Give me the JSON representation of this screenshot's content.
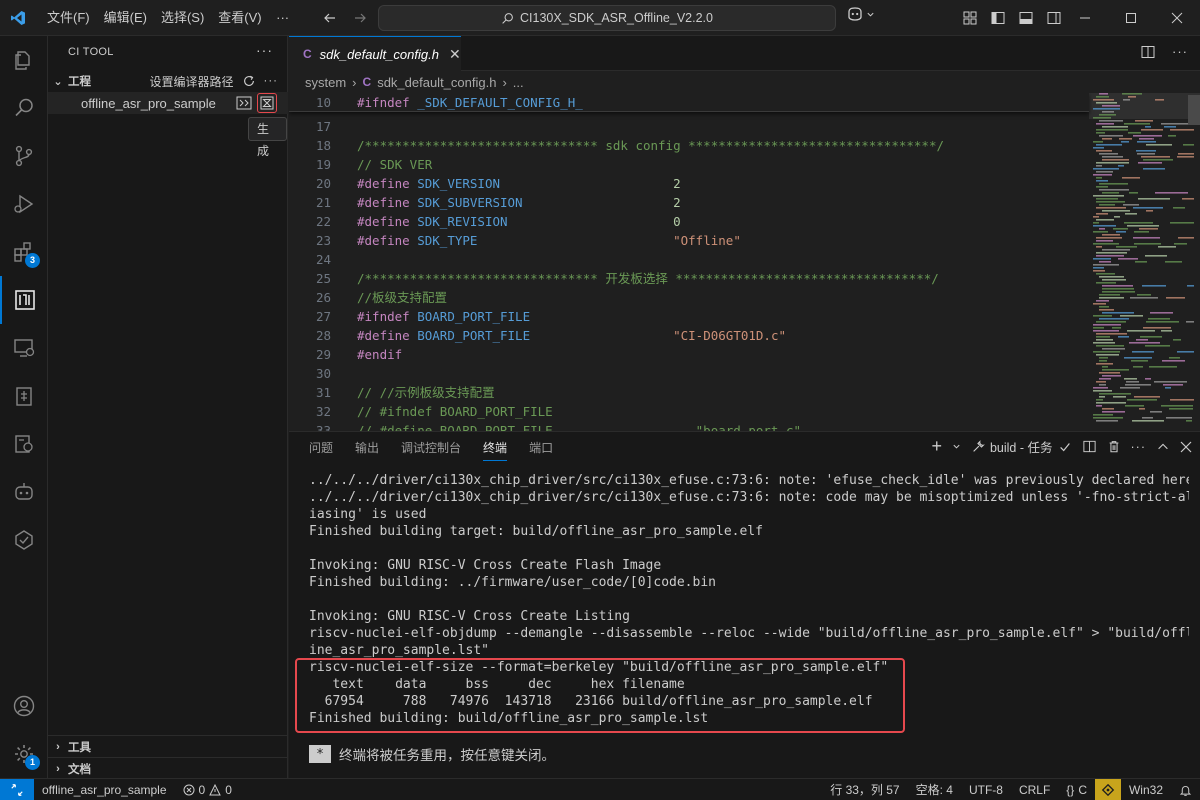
{
  "titlebar": {
    "menus": [
      "文件(F)",
      "编辑(E)",
      "选择(S)",
      "查看(V)",
      "···"
    ],
    "search": "CI130X_SDK_ASR_Offline_V2.2.0"
  },
  "activity_badges": {
    "extensions": "3",
    "manage": "1"
  },
  "sidebar": {
    "title": "CI TOOL",
    "more": "···",
    "project_section": "工程",
    "compiler_path_label": "设置编译器路径",
    "project_item": "offline_asr_pro_sample",
    "tooltip": "生成",
    "tools_section": "工具",
    "docs_section": "文档"
  },
  "editor": {
    "tab_label": "sdk_default_config.h",
    "tab_icon": "C",
    "breadcrumb": [
      "system",
      "sdk_default_config.h",
      "..."
    ],
    "lines": [
      {
        "n": "10",
        "parts": [
          [
            "kw",
            "#ifndef"
          ],
          [
            "plain",
            " "
          ],
          [
            "mac",
            "_SDK_DEFAULT_CONFIG_H_"
          ]
        ],
        "sticky": true
      },
      {
        "n": "17",
        "parts": [
          [
            "plain",
            ""
          ]
        ]
      },
      {
        "n": "18",
        "parts": [
          [
            "cm",
            "/******************************* sdk config *********************************/"
          ]
        ]
      },
      {
        "n": "19",
        "parts": [
          [
            "cm",
            "// SDK VER"
          ]
        ]
      },
      {
        "n": "20",
        "parts": [
          [
            "kw",
            "#define"
          ],
          [
            "plain",
            " "
          ],
          [
            "mac",
            "SDK_VERSION"
          ],
          [
            "plain",
            "                       "
          ],
          [
            "num",
            "2"
          ]
        ]
      },
      {
        "n": "21",
        "parts": [
          [
            "kw",
            "#define"
          ],
          [
            "plain",
            " "
          ],
          [
            "mac",
            "SDK_SUBVERSION"
          ],
          [
            "plain",
            "                    "
          ],
          [
            "num",
            "2"
          ]
        ]
      },
      {
        "n": "22",
        "parts": [
          [
            "kw",
            "#define"
          ],
          [
            "plain",
            " "
          ],
          [
            "mac",
            "SDK_REVISION"
          ],
          [
            "plain",
            "                      "
          ],
          [
            "num",
            "0"
          ]
        ]
      },
      {
        "n": "23",
        "parts": [
          [
            "kw",
            "#define"
          ],
          [
            "plain",
            " "
          ],
          [
            "mac",
            "SDK_TYPE"
          ],
          [
            "plain",
            "                          "
          ],
          [
            "str",
            "\"Offline\""
          ]
        ]
      },
      {
        "n": "24",
        "parts": [
          [
            "plain",
            ""
          ]
        ]
      },
      {
        "n": "25",
        "parts": [
          [
            "cm",
            "/******************************* 开发板选择 **********************************/"
          ]
        ]
      },
      {
        "n": "26",
        "parts": [
          [
            "cm",
            "//板级支持配置"
          ]
        ]
      },
      {
        "n": "27",
        "parts": [
          [
            "kw",
            "#ifndef"
          ],
          [
            "plain",
            " "
          ],
          [
            "mac",
            "BOARD_PORT_FILE"
          ]
        ]
      },
      {
        "n": "28",
        "parts": [
          [
            "kw",
            "#define"
          ],
          [
            "plain",
            " "
          ],
          [
            "mac",
            "BOARD_PORT_FILE"
          ],
          [
            "plain",
            "                   "
          ],
          [
            "str",
            "\"CI-D06GT01D.c\""
          ]
        ]
      },
      {
        "n": "29",
        "parts": [
          [
            "kw",
            "#endif"
          ]
        ]
      },
      {
        "n": "30",
        "parts": [
          [
            "plain",
            ""
          ]
        ]
      },
      {
        "n": "31",
        "parts": [
          [
            "cm",
            "// //示例板级支持配置"
          ]
        ]
      },
      {
        "n": "32",
        "parts": [
          [
            "cm",
            "// #ifndef BOARD_PORT_FILE"
          ]
        ]
      },
      {
        "n": "33",
        "parts": [
          [
            "cm",
            "// #define BOARD_PORT_FILE                   \"board_port.c\""
          ]
        ]
      }
    ]
  },
  "panel": {
    "tabs": [
      "问题",
      "输出",
      "调试控制台",
      "终端",
      "端口"
    ],
    "active_tab": "终端",
    "task_label": "build - 任务",
    "terminal_lines": [
      "../../../driver/ci130x_chip_driver/src/ci130x_efuse.c:73:6: note: 'efuse_check_idle' was previously declared here",
      "../../../driver/ci130x_chip_driver/src/ci130x_efuse.c:73:6: note: code may be misoptimized unless '-fno-strict-al",
      "iasing' is used",
      "Finished building target: build/offline_asr_pro_sample.elf",
      "",
      "Invoking: GNU RISC-V Cross Create Flash Image",
      "Finished building: ../firmware/user_code/[0]code.bin",
      "",
      "Invoking: GNU RISC-V Cross Create Listing",
      "riscv-nuclei-elf-objdump --demangle --disassemble --reloc --wide \"build/offline_asr_pro_sample.elf\" > \"build/offl",
      "ine_asr_pro_sample.lst\"",
      "riscv-nuclei-elf-size --format=berkeley \"build/offline_asr_pro_sample.elf\"",
      "   text    data     bss     dec     hex filename",
      "  67954     788   74976  143718   23166 build/offline_asr_pro_sample.elf",
      "Finished building: build/offline_asr_pro_sample.lst"
    ],
    "footer_marker": "*",
    "footer_text": "终端将被任务重用，按任意键关闭。"
  },
  "statusbar": {
    "project": "offline_asr_pro_sample",
    "errors": "0",
    "warnings": "0",
    "position": "行 33，列 57",
    "spaces": "空格: 4",
    "encoding": "UTF-8",
    "eol": "CRLF",
    "language": "C",
    "platform": "Win32"
  },
  "colors": {
    "accent": "#0078d4",
    "highlight_box": "#e5484d",
    "bell": "#c8a41c"
  }
}
